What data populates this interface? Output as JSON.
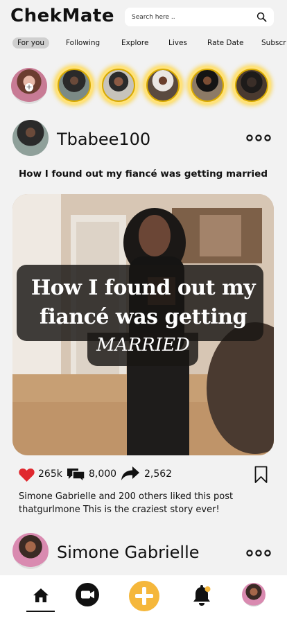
{
  "app": {
    "title": "ChekMate"
  },
  "search": {
    "placeholder": "Search here .."
  },
  "tabs": [
    {
      "label": "For you",
      "active": true
    },
    {
      "label": "Following"
    },
    {
      "label": "Explore"
    },
    {
      "label": "Lives"
    },
    {
      "label": "Rate Date"
    },
    {
      "label": "Subscr"
    }
  ],
  "stories": {
    "count": 5,
    "ring_color": "#f5c518"
  },
  "posts": [
    {
      "username": "Tbabee100",
      "title": "How I found out my fiancé was getting married",
      "image_overlay": {
        "line1": "How I found out my",
        "line2": "fiancé was getting",
        "line3": "MARRIED"
      },
      "likes": "265k",
      "comments": "8,000",
      "shares": "2,562",
      "liked_by": "Simone Gabrielle and 200 others liked this post",
      "caption": "thatgurlmone This is the craziest story ever!"
    },
    {
      "username": "Simone Gabrielle"
    }
  ],
  "nav": {
    "items": [
      {
        "icon": "home-icon"
      },
      {
        "icon": "video-camera-icon"
      },
      {
        "icon": "plus-icon"
      },
      {
        "icon": "bell-icon"
      },
      {
        "icon": "profile-avatar"
      }
    ],
    "accent": "#f5b73b"
  },
  "colors": {
    "heart": "#e0282e",
    "story_ring": "#f5c518",
    "create_button": "#f5b73b"
  }
}
